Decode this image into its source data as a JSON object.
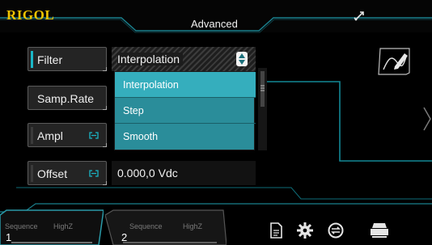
{
  "header": {
    "brand": "RIGOL",
    "mode_title": "Advanced",
    "usb_icon": "usb-icon"
  },
  "params": [
    {
      "label": "Filter",
      "value": "Interpolation",
      "control": "dropdown"
    },
    {
      "label": "Samp.Rate",
      "value": ""
    },
    {
      "label": "Ampl",
      "value": "",
      "link_icon": "link-icon"
    },
    {
      "label": "Offset",
      "value": "0.000,0 Vdc",
      "link_icon": "link-icon"
    }
  ],
  "dropdown": {
    "options": [
      "Interpolation",
      "Step",
      "Smooth"
    ],
    "selected": "Interpolation"
  },
  "channels": [
    {
      "number": "1",
      "mode": "Sequence",
      "impedance": "HighZ"
    },
    {
      "number": "2",
      "mode": "Sequence",
      "impedance": "HighZ"
    }
  ],
  "bottom_icons": [
    "document-icon",
    "gear-icon",
    "sync-icon",
    "printer-icon"
  ],
  "colors": {
    "brand": "#f0c400",
    "accent": "#1ab6c6",
    "dropdown_bg": "#2a8d9a",
    "dropdown_selected": "#35aebd",
    "waveform": "#138896"
  }
}
